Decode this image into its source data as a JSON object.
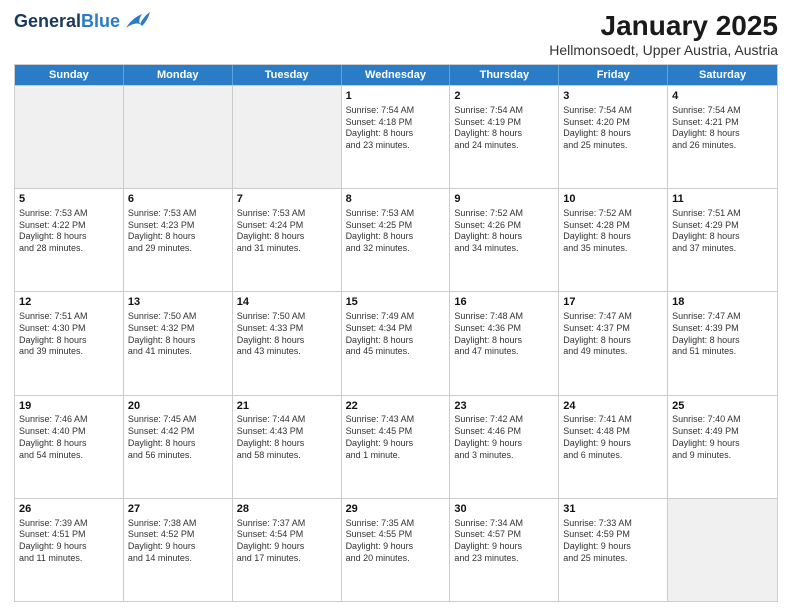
{
  "logo": {
    "general": "General",
    "blue": "Blue"
  },
  "title": "January 2025",
  "subtitle": "Hellmonsoedt, Upper Austria, Austria",
  "header_days": [
    "Sunday",
    "Monday",
    "Tuesday",
    "Wednesday",
    "Thursday",
    "Friday",
    "Saturday"
  ],
  "weeks": [
    [
      {
        "day": "",
        "info": "",
        "shaded": true
      },
      {
        "day": "",
        "info": "",
        "shaded": true
      },
      {
        "day": "",
        "info": "",
        "shaded": true
      },
      {
        "day": "1",
        "info": "Sunrise: 7:54 AM\nSunset: 4:18 PM\nDaylight: 8 hours\nand 23 minutes.",
        "shaded": false
      },
      {
        "day": "2",
        "info": "Sunrise: 7:54 AM\nSunset: 4:19 PM\nDaylight: 8 hours\nand 24 minutes.",
        "shaded": false
      },
      {
        "day": "3",
        "info": "Sunrise: 7:54 AM\nSunset: 4:20 PM\nDaylight: 8 hours\nand 25 minutes.",
        "shaded": false
      },
      {
        "day": "4",
        "info": "Sunrise: 7:54 AM\nSunset: 4:21 PM\nDaylight: 8 hours\nand 26 minutes.",
        "shaded": false
      }
    ],
    [
      {
        "day": "5",
        "info": "Sunrise: 7:53 AM\nSunset: 4:22 PM\nDaylight: 8 hours\nand 28 minutes.",
        "shaded": false
      },
      {
        "day": "6",
        "info": "Sunrise: 7:53 AM\nSunset: 4:23 PM\nDaylight: 8 hours\nand 29 minutes.",
        "shaded": false
      },
      {
        "day": "7",
        "info": "Sunrise: 7:53 AM\nSunset: 4:24 PM\nDaylight: 8 hours\nand 31 minutes.",
        "shaded": false
      },
      {
        "day": "8",
        "info": "Sunrise: 7:53 AM\nSunset: 4:25 PM\nDaylight: 8 hours\nand 32 minutes.",
        "shaded": false
      },
      {
        "day": "9",
        "info": "Sunrise: 7:52 AM\nSunset: 4:26 PM\nDaylight: 8 hours\nand 34 minutes.",
        "shaded": false
      },
      {
        "day": "10",
        "info": "Sunrise: 7:52 AM\nSunset: 4:28 PM\nDaylight: 8 hours\nand 35 minutes.",
        "shaded": false
      },
      {
        "day": "11",
        "info": "Sunrise: 7:51 AM\nSunset: 4:29 PM\nDaylight: 8 hours\nand 37 minutes.",
        "shaded": false
      }
    ],
    [
      {
        "day": "12",
        "info": "Sunrise: 7:51 AM\nSunset: 4:30 PM\nDaylight: 8 hours\nand 39 minutes.",
        "shaded": false
      },
      {
        "day": "13",
        "info": "Sunrise: 7:50 AM\nSunset: 4:32 PM\nDaylight: 8 hours\nand 41 minutes.",
        "shaded": false
      },
      {
        "day": "14",
        "info": "Sunrise: 7:50 AM\nSunset: 4:33 PM\nDaylight: 8 hours\nand 43 minutes.",
        "shaded": false
      },
      {
        "day": "15",
        "info": "Sunrise: 7:49 AM\nSunset: 4:34 PM\nDaylight: 8 hours\nand 45 minutes.",
        "shaded": false
      },
      {
        "day": "16",
        "info": "Sunrise: 7:48 AM\nSunset: 4:36 PM\nDaylight: 8 hours\nand 47 minutes.",
        "shaded": false
      },
      {
        "day": "17",
        "info": "Sunrise: 7:47 AM\nSunset: 4:37 PM\nDaylight: 8 hours\nand 49 minutes.",
        "shaded": false
      },
      {
        "day": "18",
        "info": "Sunrise: 7:47 AM\nSunset: 4:39 PM\nDaylight: 8 hours\nand 51 minutes.",
        "shaded": false
      }
    ],
    [
      {
        "day": "19",
        "info": "Sunrise: 7:46 AM\nSunset: 4:40 PM\nDaylight: 8 hours\nand 54 minutes.",
        "shaded": false
      },
      {
        "day": "20",
        "info": "Sunrise: 7:45 AM\nSunset: 4:42 PM\nDaylight: 8 hours\nand 56 minutes.",
        "shaded": false
      },
      {
        "day": "21",
        "info": "Sunrise: 7:44 AM\nSunset: 4:43 PM\nDaylight: 8 hours\nand 58 minutes.",
        "shaded": false
      },
      {
        "day": "22",
        "info": "Sunrise: 7:43 AM\nSunset: 4:45 PM\nDaylight: 9 hours\nand 1 minute.",
        "shaded": false
      },
      {
        "day": "23",
        "info": "Sunrise: 7:42 AM\nSunset: 4:46 PM\nDaylight: 9 hours\nand 3 minutes.",
        "shaded": false
      },
      {
        "day": "24",
        "info": "Sunrise: 7:41 AM\nSunset: 4:48 PM\nDaylight: 9 hours\nand 6 minutes.",
        "shaded": false
      },
      {
        "day": "25",
        "info": "Sunrise: 7:40 AM\nSunset: 4:49 PM\nDaylight: 9 hours\nand 9 minutes.",
        "shaded": false
      }
    ],
    [
      {
        "day": "26",
        "info": "Sunrise: 7:39 AM\nSunset: 4:51 PM\nDaylight: 9 hours\nand 11 minutes.",
        "shaded": false
      },
      {
        "day": "27",
        "info": "Sunrise: 7:38 AM\nSunset: 4:52 PM\nDaylight: 9 hours\nand 14 minutes.",
        "shaded": false
      },
      {
        "day": "28",
        "info": "Sunrise: 7:37 AM\nSunset: 4:54 PM\nDaylight: 9 hours\nand 17 minutes.",
        "shaded": false
      },
      {
        "day": "29",
        "info": "Sunrise: 7:35 AM\nSunset: 4:55 PM\nDaylight: 9 hours\nand 20 minutes.",
        "shaded": false
      },
      {
        "day": "30",
        "info": "Sunrise: 7:34 AM\nSunset: 4:57 PM\nDaylight: 9 hours\nand 23 minutes.",
        "shaded": false
      },
      {
        "day": "31",
        "info": "Sunrise: 7:33 AM\nSunset: 4:59 PM\nDaylight: 9 hours\nand 25 minutes.",
        "shaded": false
      },
      {
        "day": "",
        "info": "",
        "shaded": true
      }
    ]
  ]
}
